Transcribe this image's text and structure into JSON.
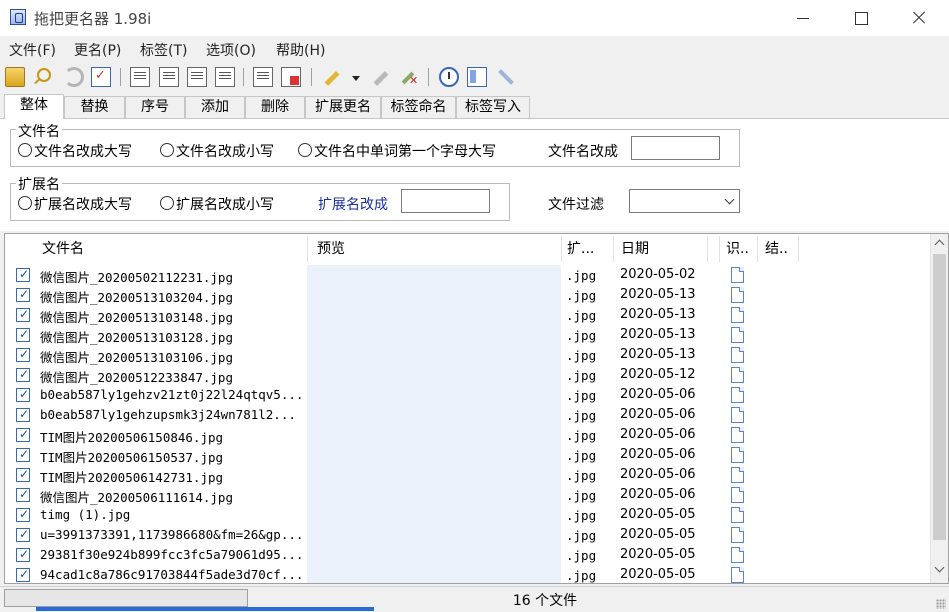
{
  "window": {
    "title": "拖把更名器 1.98i"
  },
  "menu": [
    "文件(F)",
    "更名(P)",
    "标签(T)",
    "选项(O)",
    "帮助(H)"
  ],
  "toolbar_icons": [
    "open-folder-icon",
    "search-icon",
    "undo-icon",
    "check-icon",
    "doc-a-icon",
    "doc-b-icon",
    "doc-c-icon",
    "doc-d-icon",
    "list-icon",
    "export-icon",
    "rename-pen-icon",
    "dropdown-caret-icon",
    "pen-gray-icon",
    "pen-delete-icon",
    "clock-icon",
    "window-icon",
    "tool-icon"
  ],
  "tabs": [
    "整体",
    "替换",
    "序号",
    "添加",
    "删除",
    "扩展更名",
    "标签命名",
    "标签写入"
  ],
  "panel": {
    "filename_group": "文件名",
    "filename_options": [
      "文件名改成大写",
      "文件名改成小写",
      "文件名中单词第一个字母大写"
    ],
    "filename_change_label": "文件名改成",
    "filename_change_value": "",
    "ext_group": "扩展名",
    "ext_options": [
      "扩展名改成大写",
      "扩展名改成小写"
    ],
    "ext_change_label": "扩展名改成",
    "ext_change_value": "",
    "filter_label": "文件过滤",
    "filter_value": ""
  },
  "columns": [
    "文件名",
    "预览",
    "扩...",
    "日期",
    "识..",
    "结.."
  ],
  "files": [
    {
      "name": "微信图片_20200502112231.jpg",
      "ext": ".jpg",
      "date": "2020-05-02"
    },
    {
      "name": "微信图片_20200513103204.jpg",
      "ext": ".jpg",
      "date": "2020-05-13"
    },
    {
      "name": "微信图片_20200513103148.jpg",
      "ext": ".jpg",
      "date": "2020-05-13"
    },
    {
      "name": "微信图片_20200513103128.jpg",
      "ext": ".jpg",
      "date": "2020-05-13"
    },
    {
      "name": "微信图片_20200513103106.jpg",
      "ext": ".jpg",
      "date": "2020-05-13"
    },
    {
      "name": "微信图片_20200512233847.jpg",
      "ext": ".jpg",
      "date": "2020-05-12"
    },
    {
      "name": "b0eab587ly1gehzv21zt0j22l24qtqv5...",
      "ext": ".jpg",
      "date": "2020-05-06"
    },
    {
      "name": "b0eab587ly1gehzupsmk3j24wn781l2...",
      "ext": ".jpg",
      "date": "2020-05-06"
    },
    {
      "name": "TIM图片20200506150846.jpg",
      "ext": ".jpg",
      "date": "2020-05-06"
    },
    {
      "name": "TIM图片20200506150537.jpg",
      "ext": ".jpg",
      "date": "2020-05-06"
    },
    {
      "name": "TIM图片20200506142731.jpg",
      "ext": ".jpg",
      "date": "2020-05-06"
    },
    {
      "name": "微信图片_20200506111614.jpg",
      "ext": ".jpg",
      "date": "2020-05-06"
    },
    {
      "name": "timg (1).jpg",
      "ext": ".jpg",
      "date": "2020-05-05"
    },
    {
      "name": "u=3991373391,1173986680&fm=26&gp...",
      "ext": ".jpg",
      "date": "2020-05-05"
    },
    {
      "name": "29381f30e924b899fcc3fc5a79061d95...",
      "ext": ".jpg",
      "date": "2020-05-05"
    },
    {
      "name": "94cad1c8a786c91703844f5ade3d70cf...",
      "ext": ".jpg",
      "date": "2020-05-05"
    }
  ],
  "status": {
    "text": "16 个文件",
    "progress": 0
  }
}
